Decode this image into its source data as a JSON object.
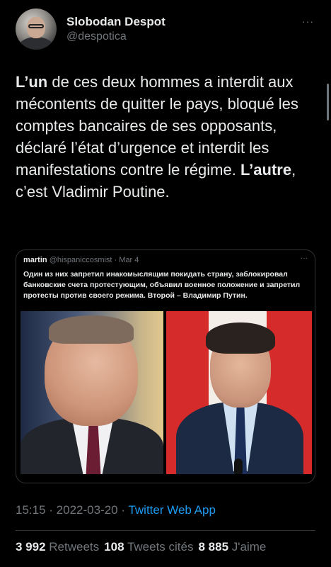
{
  "author": {
    "name": "Slobodan Despot",
    "handle": "@despotica"
  },
  "more_label": "···",
  "tweet": {
    "seg1_bold": "L’un",
    "seg2": " de ces deux hommes a interdit aux mécontents de quitter le pays, bloqué les comptes bancaires de ses opposants, déclaré l’état d’urgence et interdit les manifestations contre le régime. ",
    "seg3_bold": "L’autre",
    "seg4": ", c’est Vladimir Poutine."
  },
  "quoted": {
    "name": "martin",
    "handle": "@hispaniccosmist",
    "separator": " · ",
    "date": "Mar 4",
    "more_label": "···",
    "text": "Один из них запретил инакомыслящим покидать страну, заблокировал банковские счета протестующим, объявил военное положение и запретил протесты против своего режима. Второй – Владимир Путин."
  },
  "meta": {
    "time": "15:15",
    "separator": " · ",
    "date": "2022-03-20",
    "source": "Twitter Web App"
  },
  "stats": {
    "retweets_count": "3 992",
    "retweets_label": "Retweets",
    "quotes_count": "108",
    "quotes_label": "Tweets cités",
    "likes_count": "8 885",
    "likes_label": "J'aime"
  },
  "colors": {
    "background": "#000000",
    "text": "#e7e9ea",
    "secondary": "#71767b",
    "link": "#1d9bf0",
    "border": "#2f3336"
  }
}
